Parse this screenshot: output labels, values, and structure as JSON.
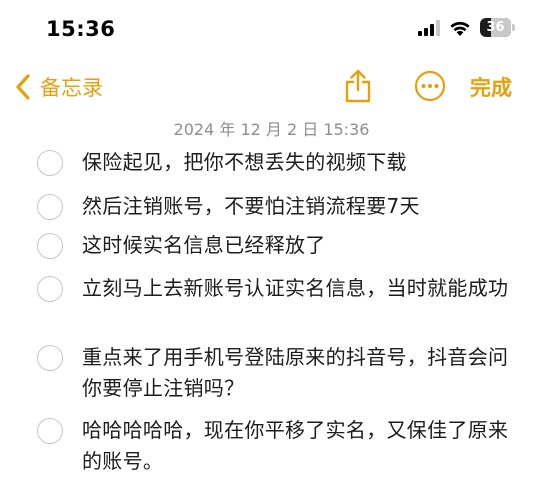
{
  "status_bar": {
    "time": "15:36",
    "battery_label": "36",
    "battery_level": 0.36
  },
  "nav": {
    "back_label": "备忘录",
    "done_label": "完成"
  },
  "note": {
    "timestamp": "2024 年 12 月 2 日 15:36",
    "items": [
      {
        "text": "保险起见，把你不想丢失的视频下载",
        "checked": false
      },
      {
        "text": "然后注销账号，不要怕注销流程要7天",
        "checked": false
      },
      {
        "text": "这时候实名信息已经释放了",
        "checked": false
      },
      {
        "text": "立刻马上去新账号认证实名信息，当时就能成功",
        "checked": false
      },
      {
        "text": "重点来了用手机号登陆原来的抖音号，抖音会问你要停止注销吗？",
        "checked": false
      },
      {
        "text": "哈哈哈哈哈，现在你平移了实名，又保佳了原来的账号。",
        "checked": false
      }
    ]
  },
  "colors": {
    "accent": "#e5a00d",
    "timestamp": "#8e8e93",
    "checkbox_border": "#c7c7cc",
    "text": "#1c1c1e"
  },
  "icons": {
    "back": "chevron-left-icon",
    "share": "share-icon",
    "more": "ellipsis-circle-icon",
    "signal": "cellular-signal-icon",
    "wifi": "wifi-icon",
    "battery": "battery-icon"
  }
}
